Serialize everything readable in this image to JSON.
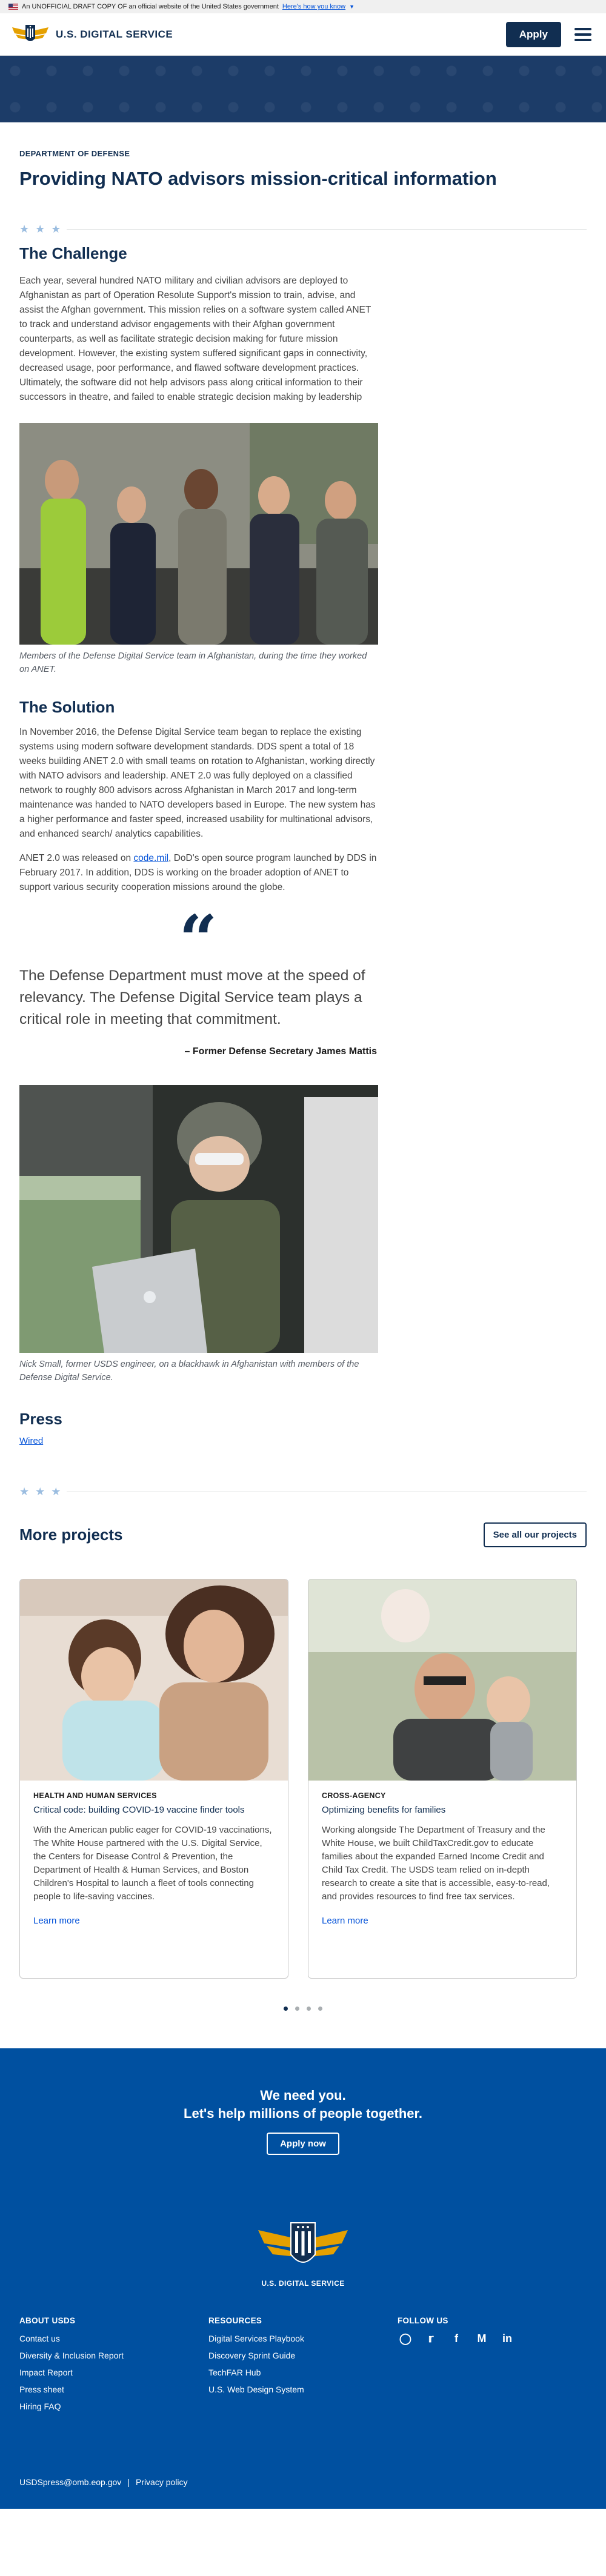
{
  "banner": {
    "text": "An UNOFFICIAL DRAFT COPY OF an official website of the United States government",
    "link": "Here's how you know"
  },
  "header": {
    "logo_text": "U.S. DIGITAL SERVICE",
    "apply": "Apply"
  },
  "article": {
    "agency": "DEPARTMENT OF DEFENSE",
    "title": "Providing NATO advisors mission-critical information",
    "challenge_heading": "The Challenge",
    "challenge_text": "Each year, several hundred NATO military and civilian advisors are deployed to Afghanistan as part of Operation Resolute Support's mission to train, advise, and assist the Afghan government. This mission relies on a software system called ANET to track and understand advisor engagements with their Afghan government counterparts, as well as facilitate strategic decision making for future mission development. However, the existing system suffered significant gaps in connectivity, decreased usage, poor performance, and flawed software development practices. Ultimately, the software did not help advisors pass along critical information to their successors in theatre, and failed to enable strategic decision making by leadership",
    "photo1_caption": "Members of the Defense Digital Service team in Afghanistan, during the time they worked on ANET.",
    "solution_heading": "The Solution",
    "solution_text1": "In November 2016, the Defense Digital Service team began to replace the existing systems using modern software development standards. DDS spent a total of 18 weeks building ANET 2.0 with small teams on rotation to Afghanistan, working directly with NATO advisors and leadership. ANET 2.0 was fully deployed on a classified network to roughly 800 advisors across Afghanistan in March 2017 and long-term maintenance was handed to NATO developers based in Europe. The new system has a higher performance and faster speed, increased usability for multinational advisors, and enhanced search/ analytics capabilities.",
    "solution_text2_pre": "ANET 2.0 was released on ",
    "solution_text2_link": "code.mil",
    "solution_text2_post": ", DoD's open source program launched by DDS in February 2017. In addition, DDS is working on the broader adoption of ANET to support various security cooperation missions around the globe.",
    "quote": "The Defense Department must move at the speed of relevancy. The Defense Digital Service team plays a critical role in meeting that commitment.",
    "quote_attribution": "– Former Defense Secretary James Mattis",
    "photo2_caption": "Nick Small, former USDS engineer, on a blackhawk in Afghanistan with members of the Defense Digital Service.",
    "press_heading": "Press",
    "press_link": "Wired"
  },
  "more": {
    "heading": "More projects",
    "all_button": "See all our projects",
    "cards": [
      {
        "category": "HEALTH AND HUMAN SERVICES",
        "title": "Critical code: building COVID-19 vaccine finder tools",
        "desc": "With the American public eager for COVID-19 vaccinations, The White House partnered with the U.S. Digital Service, the Centers for Disease Control & Prevention, the Department of Health & Human Services, and Boston Children's Hospital to launch a fleet of tools connecting people to life-saving vaccines.",
        "link": "Learn more"
      },
      {
        "category": "CROSS-AGENCY",
        "title": "Optimizing benefits for families",
        "desc": "Working alongside The Department of Treasury and the White House, we built ChildTaxCredit.gov to educate families about the expanded Earned Income Credit and Child Tax Credit. The USDS team relied on in-depth research to create a site that is accessible, easy-to-read, and provides resources to find free tax services.",
        "link": "Learn more"
      }
    ],
    "active_dot": 1,
    "dot_count": 4
  },
  "cta": {
    "line1": "We need you.",
    "line2": "Let's help millions of people together.",
    "button": "Apply now"
  },
  "footer": {
    "logo_text": "U.S. DIGITAL SERVICE",
    "about": {
      "heading": "ABOUT USDS",
      "links": [
        "Contact us",
        "Diversity & Inclusion Report",
        "Impact Report",
        "Press sheet",
        "Hiring FAQ"
      ]
    },
    "resources": {
      "heading": "RESOURCES",
      "links": [
        "Digital Services Playbook",
        "Discovery Sprint Guide",
        "TechFAR Hub",
        "U.S. Web Design System"
      ]
    },
    "follow": {
      "heading": "FOLLOW US",
      "icons": [
        "instagram-icon",
        "twitter-icon",
        "facebook-icon",
        "medium-icon",
        "linkedin-icon"
      ]
    },
    "email": "USDSpress@omb.eop.gov",
    "sep": "|",
    "privacy": "Privacy policy"
  },
  "colors": {
    "navy": "#112e51",
    "link": "#0050d8",
    "footer_blue": "#0050a0",
    "star": "#9bbde0"
  }
}
